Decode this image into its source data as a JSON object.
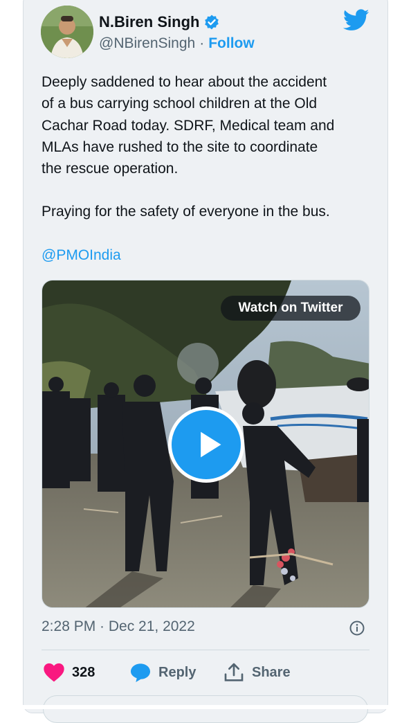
{
  "author": {
    "name": "N.Biren Singh",
    "handle": "@NBirenSingh",
    "separator": "·",
    "follow_label": "Follow"
  },
  "tweet": {
    "text_line1": "Deeply saddened to hear about the accident",
    "text_line2": "of a bus carrying school children at the Old",
    "text_line3": "Cachar Road today. SDRF, Medical team and",
    "text_line4": "MLAs have rushed to the site to coordinate",
    "text_line5": "the rescue operation.",
    "text_para2": "Praying for the safety of everyone in the bus.",
    "mention": "@PMOIndia"
  },
  "media": {
    "watch_label": "Watch on Twitter"
  },
  "meta": {
    "timestamp": "2:28 PM · Dec 21, 2022"
  },
  "actions": {
    "likes": "328",
    "reply_label": "Reply",
    "share_label": "Share"
  },
  "colors": {
    "accent": "#1d9bf0",
    "like": "#f91880",
    "text": "#0f1419",
    "muted": "#536471"
  }
}
